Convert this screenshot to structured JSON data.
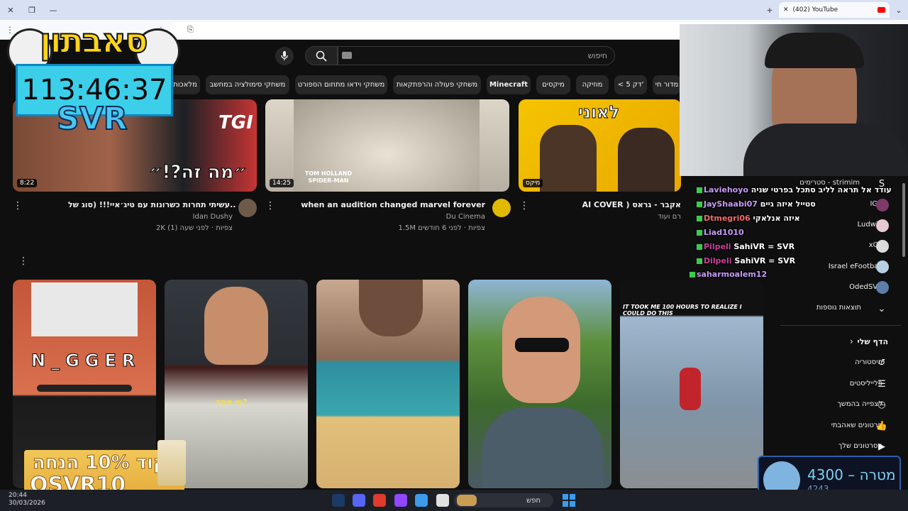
{
  "browser": {
    "tab_title": "(402) YouTube",
    "new_tab": "+",
    "close_tab": "✕"
  },
  "search": {
    "placeholder": "חיפוש"
  },
  "chips": [
    {
      "label": "מדור חי"
    },
    {
      "label": "< 5 דק'"
    },
    {
      "label": "מוזיקה"
    },
    {
      "label": "מיקסים"
    },
    {
      "label": "Minecraft"
    },
    {
      "label": "משחקי פעולה והרפתקאות"
    },
    {
      "label": "משחקי וידאו מתחום הספורט"
    },
    {
      "label": "משחקי סימולציה במחשב"
    },
    {
      "label": "מלאכות"
    }
  ],
  "videos": [
    {
      "title": "עשיתי תחרות כשרונות עם טיג׳איי!!! (סוג של... 😂",
      "channel": "Idan Dushy",
      "meta": "2K צפיות · לפני שעה (1)",
      "duration": "8:22",
      "thumb_text": "״מה זה?!״"
    },
    {
      "title": "when an audition changed marvel forever",
      "channel": "Du Cinema",
      "meta": "1.5M צפיות · לפני 6 חודשים",
      "duration": "14:25",
      "thumb_text": "TOM HOLLAND SPIDER-MAN"
    },
    {
      "title": "AI COVER ) אקבר - גראס",
      "channel": "רם ועוד",
      "meta": "",
      "duration": "מיקס",
      "thumb_text": "לאוני"
    }
  ],
  "shorts": [
    {
      "thumb_text": "N_GGER"
    },
    {
      "thumb_text": "מי אתה?"
    },
    {
      "thumb_text": ""
    },
    {
      "thumb_text": ""
    },
    {
      "thumb_text": "IT TOOK ME 100 HOURS TO REALIZE I COULD DO THIS"
    }
  ],
  "sidebar": {
    "subscriptions": [
      {
        "label": "IGZ"
      },
      {
        "label": "Ludwin"
      },
      {
        "label": "xQc"
      },
      {
        "label": "Israel eFootball"
      },
      {
        "label": "OdedSVR"
      }
    ],
    "show_more": "תוצאות נוספות",
    "you_heading": "הדף שלי",
    "you_items": [
      {
        "label": "היסטוריה",
        "icon": "history-icon"
      },
      {
        "label": "פלייליסטים",
        "icon": "playlist-icon"
      },
      {
        "label": "לצפייה בהמשך",
        "icon": "clock-icon"
      },
      {
        "label": "סרטונים שאהבתי",
        "icon": "thumbs-up-icon"
      },
      {
        "label": "הסרטונים שלך",
        "icon": "play-icon"
      }
    ],
    "streamer_label": "סטרימים - strimim"
  },
  "chat": [
    {
      "user": "Laviehoyo",
      "msg": "עודד אל תראה לליב סתכל בפרטי שניה"
    },
    {
      "user": "JayShaabi07",
      "msg": "סטייל איזה גיים"
    },
    {
      "user": "Dtmegri06",
      "msg": "איזה אנלאקי"
    },
    {
      "user": "Liad1010",
      "msg": ""
    },
    {
      "user": "Pilpeli",
      "msg": "SahiVR = SVR"
    },
    {
      "user": "Dilpeli",
      "msg": "SahiVR = SVR"
    },
    {
      "user": "saharmoalem12",
      "msg": ""
    }
  ],
  "overlay": {
    "logo": "סאבתון",
    "timer": "113:46:37",
    "svr": "SVR",
    "promo_line1": "קוד 10% הנחה",
    "promo_line2": "OSVR10",
    "goal_label": "מטרה",
    "goal_target": "4300",
    "goal_current": "4243"
  },
  "taskbar": {
    "search": "חפש",
    "time": "20:44",
    "date": "30/03/2026"
  }
}
